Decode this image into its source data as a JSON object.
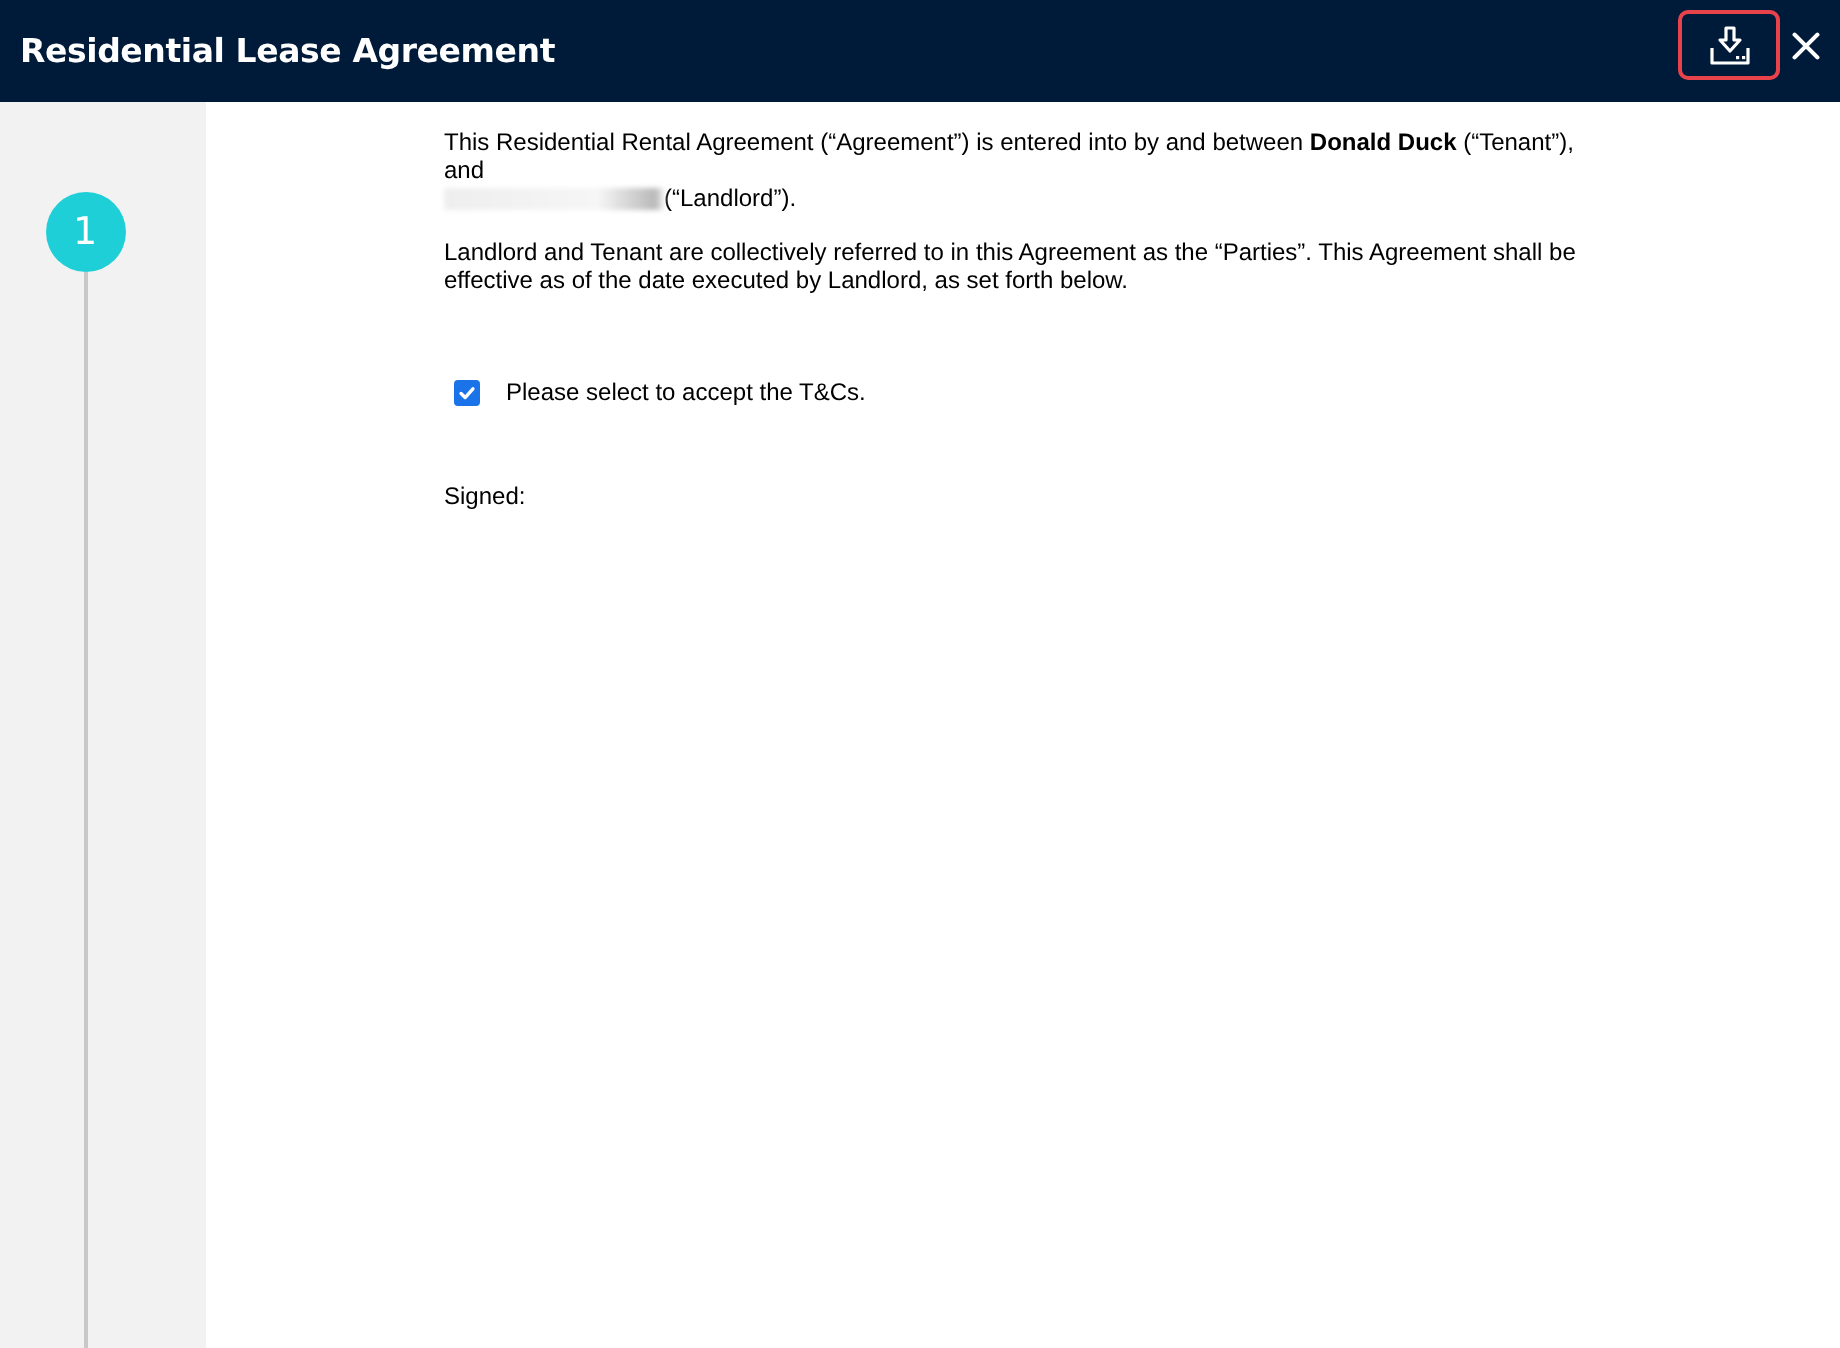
{
  "window": {
    "title": "Residential Lease Agreement"
  },
  "header_actions": {
    "download": {
      "highlighted": true
    }
  },
  "stepper": {
    "steps": [
      {
        "number": "1",
        "selected": true
      }
    ]
  },
  "agreement": {
    "intro": "This Residential Rental Agreement (“Agreement”) is entered into by and between **Donald Duck** (“Tenant”), and",
    "landlord": {
      "redacted": true,
      "suffix": "(“Landlord”)."
    },
    "paragraph": "Landlord and Tenant are collectively referred to in this Agreement as the “Parties”. This Agreement shall be effective as of the date executed by Landlord, as set forth below.",
    "accept": {
      "label": "Please select to accept the T&Cs.",
      "checked": true
    },
    "signature": {
      "label": "Signed:"
    }
  }
}
